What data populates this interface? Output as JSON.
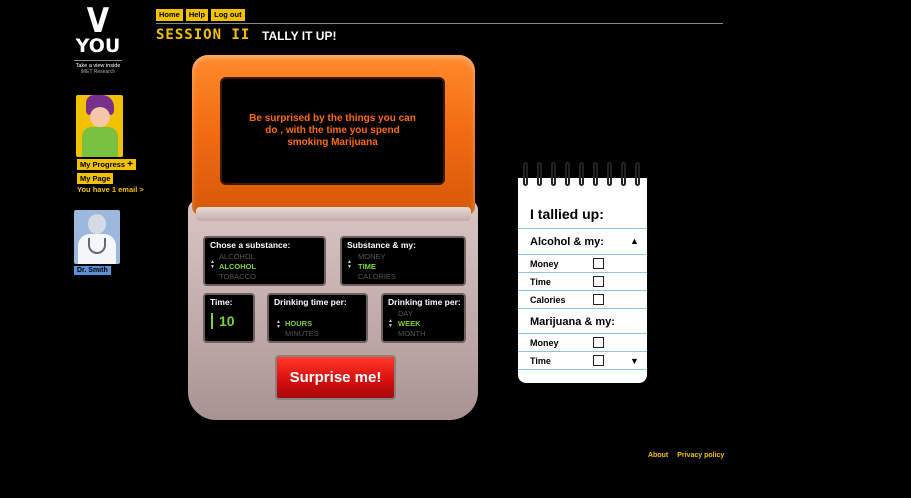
{
  "brand": {
    "logo_v": "V",
    "logo_you": "YOU",
    "tagline": "Take a view inside",
    "org": "iMET Research"
  },
  "nav": {
    "home": "Home",
    "help": "Help",
    "logout": "Log out"
  },
  "sidebar": {
    "my_progress": "My Progress",
    "my_progress_icon": "+",
    "my_page": "My Page",
    "email_notice": "You have 1 email >",
    "doctor_label": "Dr. Smith"
  },
  "session": {
    "label": "SESSION II",
    "title": "TALLY IT UP!"
  },
  "device": {
    "screen_text": "Be surprised by the things you can do , with the time you spend smoking Marijuana",
    "substance": {
      "title": "Chose a substance:",
      "options": [
        "ALCOHOL",
        "ALCOHOL",
        "TOBACCO"
      ]
    },
    "measure": {
      "title": "Substance & my:",
      "options": [
        "MONEY",
        "TIME",
        "CALORIES"
      ]
    },
    "time": {
      "title": "Time:",
      "value": "10"
    },
    "unit": {
      "title": "Drinking time per:",
      "options": [
        "HOURS",
        "MINUTES"
      ]
    },
    "period": {
      "title": "Drinking time per:",
      "options": [
        "DAY",
        "WEEK",
        "MONTH"
      ]
    },
    "button": "Surprise me!"
  },
  "notepad": {
    "title": "I tallied up:",
    "sections": [
      {
        "name": "Alcohol & my:",
        "items": [
          "Money",
          "Time",
          "Calories"
        ]
      },
      {
        "name": "Marijuana & my:",
        "items": [
          "Money",
          "Time"
        ]
      }
    ],
    "up_arrow": "▲",
    "down_arrow": "▼"
  },
  "footer": {
    "about": "About",
    "privacy": "Privacy policy"
  },
  "colors": {
    "accent_yellow": "#f2c200",
    "device_orange": "#f16a12",
    "screen_text": "#ff6a10",
    "selected_green": "#7cd23a",
    "button_red": "#d90f0f"
  }
}
